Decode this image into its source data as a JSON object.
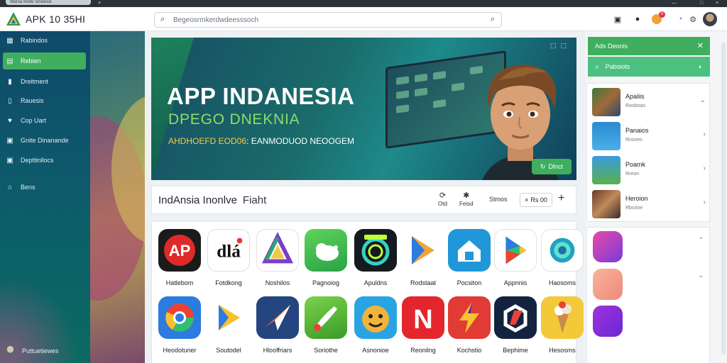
{
  "window": {
    "title": "Warsa·Invite Sinowsis",
    "tab_close": "×"
  },
  "header": {
    "brand": "APK 10 35HI",
    "search_placeholder": "Begeosrmkerdwdeesssoch",
    "badge_count": "0"
  },
  "sidebar": {
    "items": [
      {
        "label": "Rabindos",
        "icon": "grid-icon"
      },
      {
        "label": "Rebien",
        "icon": "store-icon",
        "active": true
      },
      {
        "label": "Dreitment",
        "icon": "bookmark-icon"
      },
      {
        "label": "Rauesis",
        "icon": "lock-icon"
      },
      {
        "label": "Cop Uart",
        "icon": "heart-icon"
      },
      {
        "label": "Gnite Dinanande",
        "icon": "image-icon"
      },
      {
        "label": "Depttinllocs",
        "icon": "download-icon"
      },
      {
        "label": "Bens",
        "icon": "home-icon"
      }
    ],
    "user_name": "Puttuetiewes"
  },
  "banner": {
    "title": "APP INDANESIA",
    "subtitle": "DPEGO DNEKNIA",
    "tag_yellow": "AHDHOEFD EOD06",
    "tag_white": ": EANMODUOD NEOOGEM",
    "button": "Dlnct"
  },
  "list_header": {
    "title": "IndAnsia Inonlve",
    "title_suffix": "Fiaht",
    "ctl1": "Otd",
    "ctl2": "Feisd",
    "sort_label": "Stmos",
    "pill": "Rs 00",
    "plus": "+"
  },
  "apps": [
    {
      "label": "Hatlebom",
      "kind": "ap-red"
    },
    {
      "label": "Fotdkong",
      "kind": "dla"
    },
    {
      "label": "Noshilos",
      "kind": "tri"
    },
    {
      "label": "Pagnoiog",
      "kind": "green-cloud"
    },
    {
      "label": "Apuldns",
      "kind": "ring"
    },
    {
      "label": "Rodstaat",
      "kind": "play"
    },
    {
      "label": "Pocsiton",
      "kind": "blue-home"
    },
    {
      "label": "Appnnis",
      "kind": "play-white"
    },
    {
      "label": "Haosoms",
      "kind": "lens"
    },
    {
      "label": "Heodotuner",
      "kind": "chrome"
    },
    {
      "label": "Soutodel",
      "kind": "play-yellow"
    },
    {
      "label": "Hlooffriars",
      "kind": "plane"
    },
    {
      "label": "Soriothe",
      "kind": "brush"
    },
    {
      "label": "Asnonioe",
      "kind": "smile"
    },
    {
      "label": "Reonilng",
      "kind": "n-red"
    },
    {
      "label": "Kochstio",
      "kind": "bolt"
    },
    {
      "label": "Bephime",
      "kind": "dash"
    },
    {
      "label": "Hesosms",
      "kind": "cone"
    }
  ],
  "rail": {
    "top_title": "Ads Deonis",
    "sub_title": "Pabsiots",
    "rows": [
      {
        "title": "Apaliis",
        "sub": "Rooboas"
      },
      {
        "title": "Panaios",
        "sub": "Rnsoes"
      },
      {
        "title": "Poamk",
        "sub": "Rreon"
      },
      {
        "title": "Heroion",
        "sub": "Rbsrioe"
      }
    ]
  }
}
